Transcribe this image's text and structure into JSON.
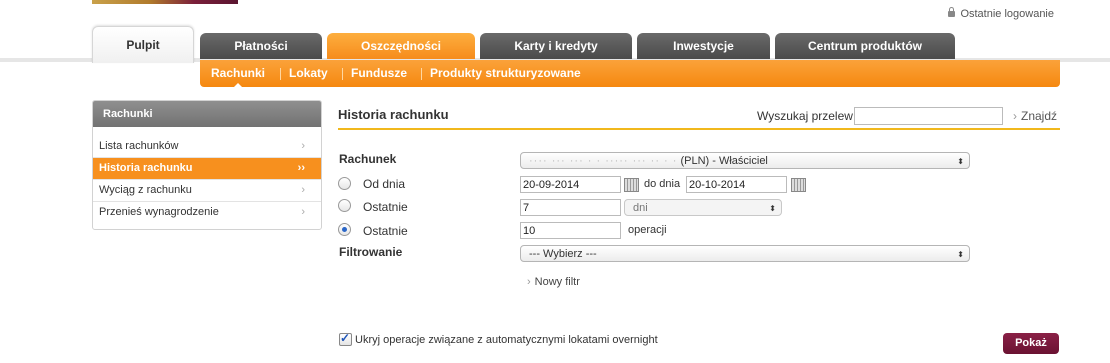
{
  "header": {
    "last_login": "Ostatnie logowanie"
  },
  "main_tabs": [
    {
      "label": "Pulpit"
    },
    {
      "label": "Płatności"
    },
    {
      "label": "Oszczędności"
    },
    {
      "label": "Karty i kredyty"
    },
    {
      "label": "Inwestycje"
    },
    {
      "label": "Centrum produktów"
    }
  ],
  "sub_tabs": [
    {
      "label": "Rachunki"
    },
    {
      "label": "Lokaty"
    },
    {
      "label": "Fundusze"
    },
    {
      "label": "Produkty strukturyzowane"
    }
  ],
  "sidebar": {
    "title": "Rachunki",
    "items": [
      {
        "label": "Lista rachunków",
        "chev": "›"
      },
      {
        "label": "Historia rachunku",
        "chev": "››"
      },
      {
        "label": "Wyciąg z rachunku",
        "chev": "›"
      },
      {
        "label": "Przenieś wynagrodzenie",
        "chev": "›"
      }
    ]
  },
  "main": {
    "title": "Historia rachunku",
    "search": {
      "label": "Wyszukaj przelew",
      "value": "",
      "button": "Znajdź"
    },
    "account": {
      "label": "Rachunek",
      "masked": "···· ··· ··· · · ····· ··· ·· · ·",
      "value": "(PLN)  - Właściciel"
    },
    "from_date": {
      "label": "Od dnia",
      "value": "20-09-2014"
    },
    "to_date": {
      "label": "do dnia",
      "value": "20-10-2014"
    },
    "last_days": {
      "label": "Ostatnie",
      "value": "7",
      "unit": "dni"
    },
    "last_ops": {
      "label": "Ostatnie",
      "value": "10",
      "unit": "operacji"
    },
    "filter": {
      "label": "Filtrowanie",
      "value": "--- Wybierz ---"
    },
    "new_filter": "Nowy filtr",
    "hide_overnight": {
      "label": "Ukryj operacje związane z automatycznymi lokatami overnight",
      "checked": true
    },
    "show_button": "Pokaż"
  }
}
